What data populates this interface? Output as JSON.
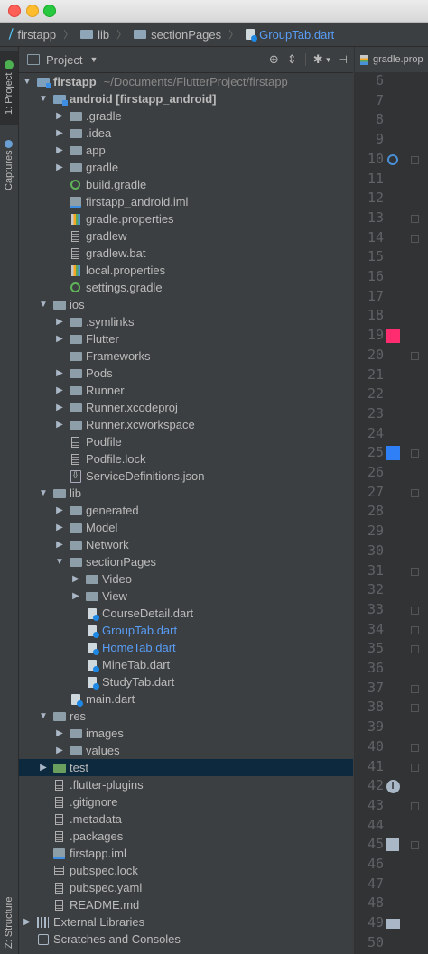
{
  "breadcrumbs": [
    {
      "label": "firstapp",
      "icon": "flutter-icon",
      "active": false
    },
    {
      "label": "lib",
      "icon": "folder-icon",
      "active": false
    },
    {
      "label": "sectionPages",
      "icon": "folder-icon",
      "active": false
    },
    {
      "label": "GroupTab.dart",
      "icon": "dart-file-icon",
      "active": true
    }
  ],
  "side_tabs": {
    "project": "1: Project",
    "captures": "Captures",
    "structure": "Z: Structure"
  },
  "panel": {
    "view_label": "Project",
    "toolbar_icons": [
      "target-icon",
      "collapse-icon",
      "gear-icon",
      "hide-icon"
    ]
  },
  "tree": [
    {
      "label": "firstapp",
      "extra": "~/Documents/FlutterProject/firstapp",
      "level": 0,
      "arrow": "down",
      "icon": "project-folder",
      "bold": true
    },
    {
      "label": "android [firstapp_android]",
      "level": 1,
      "arrow": "down",
      "icon": "module-folder",
      "bold": true
    },
    {
      "label": ".gradle",
      "level": 2,
      "arrow": "right",
      "icon": "folder"
    },
    {
      "label": ".idea",
      "level": 2,
      "arrow": "right",
      "icon": "folder"
    },
    {
      "label": "app",
      "level": 2,
      "arrow": "right",
      "icon": "folder"
    },
    {
      "label": "gradle",
      "level": 2,
      "arrow": "right",
      "icon": "folder"
    },
    {
      "label": "build.gradle",
      "level": 2,
      "arrow": "",
      "icon": "gradle"
    },
    {
      "label": "firstapp_android.iml",
      "level": 2,
      "arrow": "",
      "icon": "iml"
    },
    {
      "label": "gradle.properties",
      "level": 2,
      "arrow": "",
      "icon": "properties"
    },
    {
      "label": "gradlew",
      "level": 2,
      "arrow": "",
      "icon": "file"
    },
    {
      "label": "gradlew.bat",
      "level": 2,
      "arrow": "",
      "icon": "file"
    },
    {
      "label": "local.properties",
      "level": 2,
      "arrow": "",
      "icon": "properties"
    },
    {
      "label": "settings.gradle",
      "level": 2,
      "arrow": "",
      "icon": "gradle"
    },
    {
      "label": "ios",
      "level": 1,
      "arrow": "down",
      "icon": "folder"
    },
    {
      "label": ".symlinks",
      "level": 2,
      "arrow": "right",
      "icon": "folder"
    },
    {
      "label": "Flutter",
      "level": 2,
      "arrow": "right",
      "icon": "folder"
    },
    {
      "label": "Frameworks",
      "level": 2,
      "arrow": "",
      "icon": "folder"
    },
    {
      "label": "Pods",
      "level": 2,
      "arrow": "right",
      "icon": "folder"
    },
    {
      "label": "Runner",
      "level": 2,
      "arrow": "right",
      "icon": "folder"
    },
    {
      "label": "Runner.xcodeproj",
      "level": 2,
      "arrow": "right",
      "icon": "folder"
    },
    {
      "label": "Runner.xcworkspace",
      "level": 2,
      "arrow": "right",
      "icon": "folder"
    },
    {
      "label": "Podfile",
      "level": 2,
      "arrow": "",
      "icon": "file"
    },
    {
      "label": "Podfile.lock",
      "level": 2,
      "arrow": "",
      "icon": "file"
    },
    {
      "label": "ServiceDefinitions.json",
      "level": 2,
      "arrow": "",
      "icon": "json"
    },
    {
      "label": "lib",
      "level": 1,
      "arrow": "down",
      "icon": "folder"
    },
    {
      "label": "generated",
      "level": 2,
      "arrow": "right",
      "icon": "folder"
    },
    {
      "label": "Model",
      "level": 2,
      "arrow": "right",
      "icon": "folder"
    },
    {
      "label": "Network",
      "level": 2,
      "arrow": "right",
      "icon": "folder"
    },
    {
      "label": "sectionPages",
      "level": 2,
      "arrow": "down",
      "icon": "folder"
    },
    {
      "label": "Video",
      "level": 3,
      "arrow": "right",
      "icon": "folder"
    },
    {
      "label": "View",
      "level": 3,
      "arrow": "right",
      "icon": "folder"
    },
    {
      "label": "CourseDetail.dart",
      "level": 3,
      "arrow": "",
      "icon": "dart"
    },
    {
      "label": "GroupTab.dart",
      "level": 3,
      "arrow": "",
      "icon": "dart",
      "blue": true
    },
    {
      "label": "HomeTab.dart",
      "level": 3,
      "arrow": "",
      "icon": "dart",
      "blue": true
    },
    {
      "label": "MineTab.dart",
      "level": 3,
      "arrow": "",
      "icon": "dart"
    },
    {
      "label": "StudyTab.dart",
      "level": 3,
      "arrow": "",
      "icon": "dart"
    },
    {
      "label": "main.dart",
      "level": 2,
      "arrow": "",
      "icon": "dart"
    },
    {
      "label": "res",
      "level": 1,
      "arrow": "down",
      "icon": "folder"
    },
    {
      "label": "images",
      "level": 2,
      "arrow": "right",
      "icon": "folder"
    },
    {
      "label": "values",
      "level": 2,
      "arrow": "right",
      "icon": "folder"
    },
    {
      "label": "test",
      "level": 1,
      "arrow": "right",
      "icon": "test-folder",
      "selected": true
    },
    {
      "label": ".flutter-plugins",
      "level": 1,
      "arrow": "",
      "icon": "file"
    },
    {
      "label": ".gitignore",
      "level": 1,
      "arrow": "",
      "icon": "file"
    },
    {
      "label": ".metadata",
      "level": 1,
      "arrow": "",
      "icon": "file"
    },
    {
      "label": ".packages",
      "level": 1,
      "arrow": "",
      "icon": "file"
    },
    {
      "label": "firstapp.iml",
      "level": 1,
      "arrow": "",
      "icon": "iml"
    },
    {
      "label": "pubspec.lock",
      "level": 1,
      "arrow": "",
      "icon": "table"
    },
    {
      "label": "pubspec.yaml",
      "level": 1,
      "arrow": "",
      "icon": "file"
    },
    {
      "label": "README.md",
      "level": 1,
      "arrow": "",
      "icon": "file"
    },
    {
      "label": "External Libraries",
      "level": 0,
      "arrow": "right",
      "icon": "libraries"
    },
    {
      "label": "Scratches and Consoles",
      "level": 0,
      "arrow": "",
      "icon": "scratches"
    }
  ],
  "editor": {
    "tab_label": "gradle.prop",
    "line_numbers": [
      "6",
      "7",
      "8",
      "9",
      "10",
      "11",
      "12",
      "13",
      "14",
      "15",
      "16",
      "17",
      "18",
      "19",
      "20",
      "21",
      "22",
      "23",
      "24",
      "25",
      "26",
      "27",
      "28",
      "29",
      "30",
      "31",
      "32",
      "33",
      "34",
      "35",
      "36",
      "37",
      "38",
      "39",
      "40",
      "41",
      "42",
      "43",
      "44",
      "45",
      "46",
      "47",
      "48",
      "49",
      "50"
    ],
    "markers": {
      "pink": "#ff2d6f",
      "blue": "#2f7ff7"
    }
  }
}
